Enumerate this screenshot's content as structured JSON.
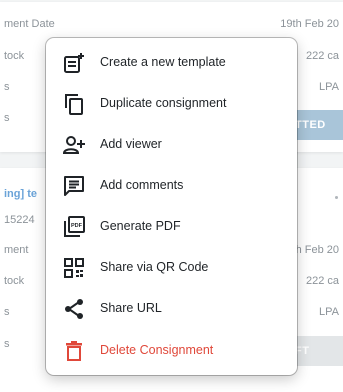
{
  "background": {
    "card1": {
      "rows": [
        {
          "label": "ment Date",
          "value": "19th Feb 20"
        },
        {
          "label": "tock",
          "value": "222 ca"
        },
        {
          "label": "s",
          "value": "LPA"
        },
        {
          "label": "s",
          "value": ""
        }
      ],
      "button_label": "TTED"
    },
    "card2": {
      "title": "ing] te",
      "subtitle": "15224",
      "rows": [
        {
          "label": "ment",
          "value": "h Feb 20"
        },
        {
          "label": "tock",
          "value": "222 ca"
        },
        {
          "label": "s",
          "value": "LPA"
        },
        {
          "label": "s",
          "value": ""
        }
      ],
      "button_label": "FT"
    }
  },
  "menu": {
    "items": [
      {
        "label": "Create a new template",
        "icon": "new-template-icon"
      },
      {
        "label": "Duplicate consignment",
        "icon": "duplicate-icon"
      },
      {
        "label": "Add viewer",
        "icon": "add-viewer-icon"
      },
      {
        "label": "Add comments",
        "icon": "comment-icon"
      },
      {
        "label": "Generate PDF",
        "icon": "pdf-icon"
      },
      {
        "label": "Share via QR Code",
        "icon": "qr-code-icon"
      },
      {
        "label": "Share URL",
        "icon": "share-icon"
      },
      {
        "label": "Delete Consignment",
        "icon": "trash-icon"
      }
    ]
  },
  "colors": {
    "danger": "#e0483a",
    "icon": "#1f2327",
    "accent": "#6aa3d8"
  }
}
